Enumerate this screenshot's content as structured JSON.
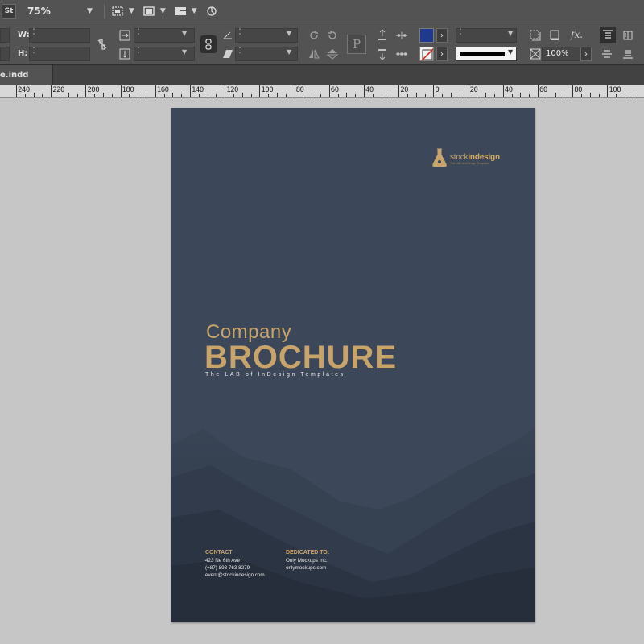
{
  "appbar": {
    "logo": "St",
    "zoom": "75%",
    "icons": [
      "frame-display-icon",
      "screen-mode-icon",
      "arrange-documents-icon",
      "publish-online-icon"
    ]
  },
  "control": {
    "w_label": "W:",
    "h_label": "H:",
    "fill_color": "#1f3a8c",
    "stroke_color": "none",
    "opacity_value": "100%",
    "icons": [
      "constrain-proportions-icon",
      "scale-x-icon",
      "scale-y-icon",
      "rotate-icon",
      "shear-icon",
      "rotate-cw-icon",
      "rotate-ccw-icon",
      "flip-horizontal-icon",
      "flip-vertical-icon",
      "reference-point-icon",
      "select-container-icon",
      "select-content-icon",
      "distribute-icon",
      "fill-swatch-icon",
      "stroke-swatch-icon",
      "stroke-weight-icon",
      "stroke-type-icon",
      "opacity-icon",
      "drop-shadow-icon",
      "effects-icon",
      "text-wrap-icon",
      "align-icon"
    ]
  },
  "tab": {
    "filename": "e.indd"
  },
  "ruler": {
    "labels": [
      "240",
      "220",
      "200",
      "180",
      "160",
      "140",
      "120",
      "100",
      "80",
      "60",
      "40",
      "20",
      "0",
      "20",
      "40",
      "60",
      "80",
      "100"
    ]
  },
  "page": {
    "brand_prefix": "stock",
    "brand_suffix": "indesign",
    "brand_tag": "The LAB of InDesign Templates",
    "title_line1": "Company",
    "title_line2": "BROCHURE",
    "tagline": "The LAB of InDesign Templates",
    "contact": {
      "heading": "CONTACT",
      "address": "423 Ne 6th Ave",
      "phone": "(+87) 893 763 8279",
      "email": "event@stockindesign.com"
    },
    "dedicated": {
      "heading": "DEDICATED TO:",
      "company": "Only Mockups Inc.",
      "site": "onlymockups.com"
    }
  }
}
